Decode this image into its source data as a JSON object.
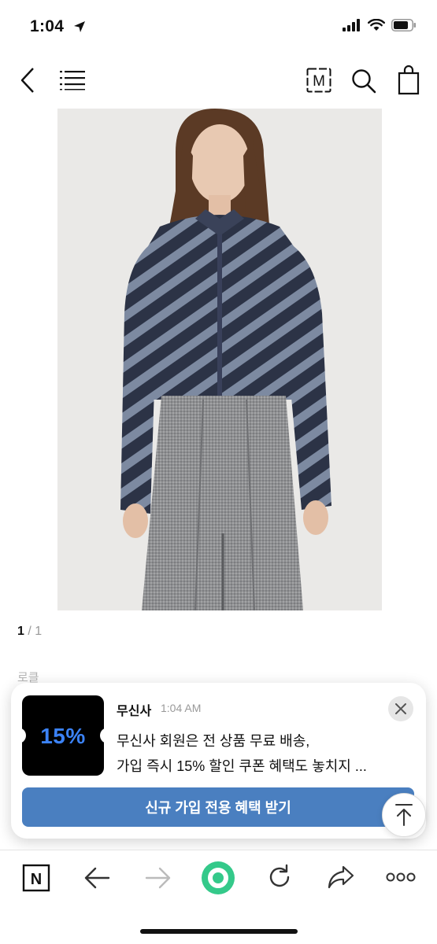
{
  "status_bar": {
    "time": "1:04"
  },
  "header": {
    "icons": [
      "back-icon",
      "menu-icon",
      "m-logo-icon",
      "search-icon",
      "shopping-bag-icon"
    ],
    "logo_letter": "M"
  },
  "product": {
    "page_current": "1",
    "page_separator": " / ",
    "page_total": "1"
  },
  "faded_label": "로클",
  "notification": {
    "app_name": "무신사",
    "time": "1:04 AM",
    "thumb_text": "15%",
    "line1": "무신사 회원은 전 상품 무료 배송,",
    "line2": "가입 즉시 15% 할인 쿠폰 혜택도 놓치지 ...",
    "cta_label": "신규 가입 전용 혜택 받기"
  },
  "bottom_bar": {
    "naver_letter": "N",
    "icons": [
      "naver-icon",
      "back-arrow-icon",
      "forward-arrow-icon",
      "green-dot-icon",
      "refresh-icon",
      "share-icon",
      "more-icon"
    ]
  },
  "colors": {
    "accent_blue": "#4a7fc0",
    "coupon_blue": "#3b82f6",
    "naver_green": "#34c98a"
  }
}
